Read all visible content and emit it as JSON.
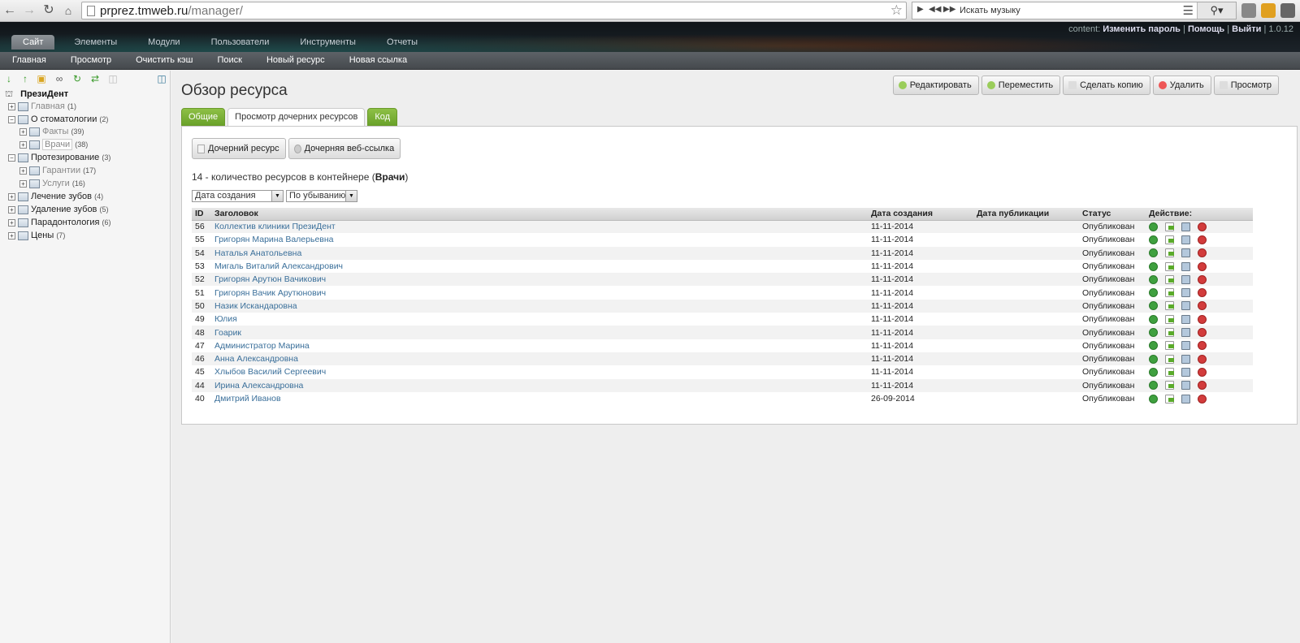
{
  "browser": {
    "url_host": "prprez.tmweb.ru",
    "url_path": "/manager/",
    "music_search_placeholder": "Искать музыку"
  },
  "header": {
    "user_prefix": "content:",
    "change_password": "Изменить пароль",
    "help": "Помощь",
    "logout": "Выйти",
    "version": "1.0.12",
    "separator": "|",
    "main_tabs": [
      "Сайт",
      "Элементы",
      "Модули",
      "Пользователи",
      "Инструменты",
      "Отчеты"
    ],
    "sub_nav": [
      "Главная",
      "Просмотр",
      "Очистить кэш",
      "Поиск",
      "Новый ресурс",
      "Новая ссылка"
    ]
  },
  "tree": {
    "root": "ПрезиДент",
    "items": [
      {
        "label": "Главная",
        "count": "(1)",
        "level": 0,
        "style": "grey"
      },
      {
        "label": "О стоматологии",
        "count": "(2)",
        "level": 0,
        "expanded": true
      },
      {
        "label": "Факты",
        "count": "(39)",
        "level": 1,
        "style": "grey"
      },
      {
        "label": "Врачи",
        "count": "(38)",
        "level": 1,
        "style": "selected"
      },
      {
        "label": "Протезирование",
        "count": "(3)",
        "level": 0,
        "expanded": true
      },
      {
        "label": "Гарантии",
        "count": "(17)",
        "level": 1,
        "style": "grey"
      },
      {
        "label": "Услуги",
        "count": "(16)",
        "level": 1,
        "style": "grey"
      },
      {
        "label": "Лечение зубов",
        "count": "(4)",
        "level": 0
      },
      {
        "label": "Удаление зубов",
        "count": "(5)",
        "level": 0
      },
      {
        "label": "Парадонтология",
        "count": "(6)",
        "level": 0
      },
      {
        "label": "Цены",
        "count": "(7)",
        "level": 0
      }
    ]
  },
  "main": {
    "title": "Обзор ресурса",
    "actions": [
      "Редактировать",
      "Переместить",
      "Сделать копию",
      "Удалить",
      "Просмотр"
    ],
    "tabs": [
      "Общие",
      "Просмотр дочерних ресурсов",
      "Код"
    ],
    "child_buttons": [
      "Дочерний ресурс",
      "Дочерняя веб-ссылка"
    ],
    "count_prefix": "14 - количество ресурсов в контейнере (",
    "count_container": "Врачи",
    "count_suffix": ")",
    "sort_field": "Дата создания",
    "sort_order": "По убыванию",
    "columns": [
      "ID",
      "Заголовок",
      "Дата создания",
      "Дата публикации",
      "Статус",
      "Действие:"
    ],
    "rows": [
      {
        "id": "56",
        "title": "Коллектив клиники ПрезиДент",
        "created": "11-11-2014",
        "published": "",
        "status": "Опубликован"
      },
      {
        "id": "55",
        "title": "Григорян Марина Валерьевна",
        "created": "11-11-2014",
        "published": "",
        "status": "Опубликован"
      },
      {
        "id": "54",
        "title": "Наталья Анатольевна",
        "created": "11-11-2014",
        "published": "",
        "status": "Опубликован"
      },
      {
        "id": "53",
        "title": "Мигаль Виталий Александрович",
        "created": "11-11-2014",
        "published": "",
        "status": "Опубликован"
      },
      {
        "id": "52",
        "title": "Григорян Арутюн Вачикович",
        "created": "11-11-2014",
        "published": "",
        "status": "Опубликован"
      },
      {
        "id": "51",
        "title": "Григорян Вачик Арутюнович",
        "created": "11-11-2014",
        "published": "",
        "status": "Опубликован"
      },
      {
        "id": "50",
        "title": "Назик Искандаровна",
        "created": "11-11-2014",
        "published": "",
        "status": "Опубликован"
      },
      {
        "id": "49",
        "title": "Юлия",
        "created": "11-11-2014",
        "published": "",
        "status": "Опубликован"
      },
      {
        "id": "48",
        "title": "Гоарик",
        "created": "11-11-2014",
        "published": "",
        "status": "Опубликован"
      },
      {
        "id": "47",
        "title": "Администратор Марина",
        "created": "11-11-2014",
        "published": "",
        "status": "Опубликован"
      },
      {
        "id": "46",
        "title": "Анна Александровна",
        "created": "11-11-2014",
        "published": "",
        "status": "Опубликован"
      },
      {
        "id": "45",
        "title": "Хлыбов Василий Сергеевич",
        "created": "11-11-2014",
        "published": "",
        "status": "Опубликован"
      },
      {
        "id": "44",
        "title": "Ирина Александровна",
        "created": "11-11-2014",
        "published": "",
        "status": "Опубликован"
      },
      {
        "id": "40",
        "title": "Дмитрий Иванов",
        "created": "26-09-2014",
        "published": "",
        "status": "Опубликован"
      }
    ]
  },
  "colors": {
    "accent_green": "#7ab23a",
    "link": "#3a6f9a",
    "header_dark": "#1c2329"
  }
}
